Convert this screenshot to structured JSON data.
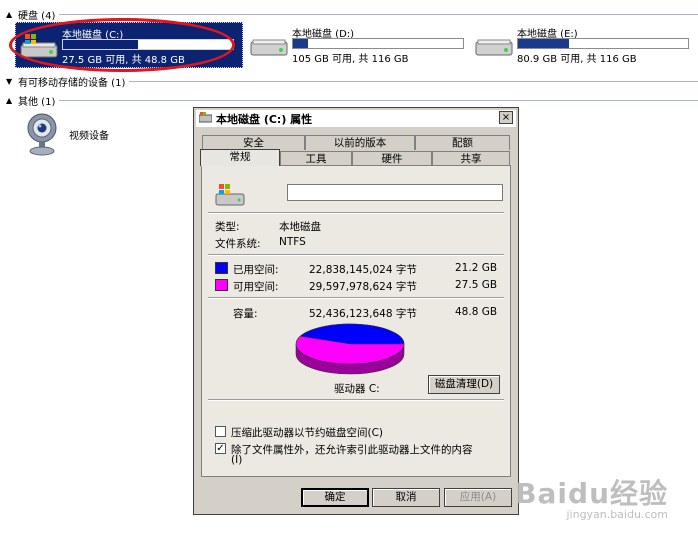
{
  "explorer": {
    "groups": [
      {
        "title": "硬盘 (4)"
      },
      {
        "title": "有可移动存储的设备 (1)"
      },
      {
        "title": "其他 (1)"
      }
    ],
    "drives": [
      {
        "name": "本地磁盘 (C:)",
        "info": "27.5 GB 可用, 共 48.8 GB",
        "used_fraction": 0.44
      },
      {
        "name": "本地磁盘 (D:)",
        "info": "105 GB 可用, 共 116 GB",
        "used_fraction": 0.09
      },
      {
        "name": "本地磁盘 (E:)",
        "info": "80.9 GB 可用, 共 116 GB",
        "used_fraction": 0.3
      }
    ],
    "other_items": [
      {
        "name": "视频设备"
      }
    ]
  },
  "dialog": {
    "title": "本地磁盘 (C:) 属性",
    "close_label": "×",
    "tabs_top": [
      "安全",
      "以前的版本",
      "配额"
    ],
    "tabs_bottom": [
      "常规",
      "工具",
      "硬件",
      "共享"
    ],
    "active_tab": "常规",
    "volume_label_value": "",
    "type_label": "类型:",
    "type_value": "本地磁盘",
    "fs_label": "文件系统:",
    "fs_value": "NTFS",
    "used": {
      "label": "已用空间:",
      "bytes": "22,838,145,024 字节",
      "size": "21.2 GB",
      "color": "#0000ff"
    },
    "free": {
      "label": "可用空间:",
      "bytes": "29,597,978,624 字节",
      "size": "27.5 GB",
      "color": "#ff00ff"
    },
    "capacity": {
      "label": "容量:",
      "bytes": "52,436,123,648 字节",
      "size": "48.8 GB"
    },
    "drive_label": "驱动器 C:",
    "cleanup_label": "磁盘清理(D)",
    "compress_label": "压缩此驱动器以节约磁盘空间(C)",
    "compress_checked": false,
    "index_label_line1": "除了文件属性外，还允许索引此驱动器上文件的内容",
    "index_label_line2": "(I)",
    "index_checked": true,
    "ok_label": "确定",
    "cancel_label": "取消",
    "apply_label": "应用(A)"
  },
  "watermark": {
    "main": "Baidu经验",
    "sub": "jingyan.baidu.com"
  }
}
